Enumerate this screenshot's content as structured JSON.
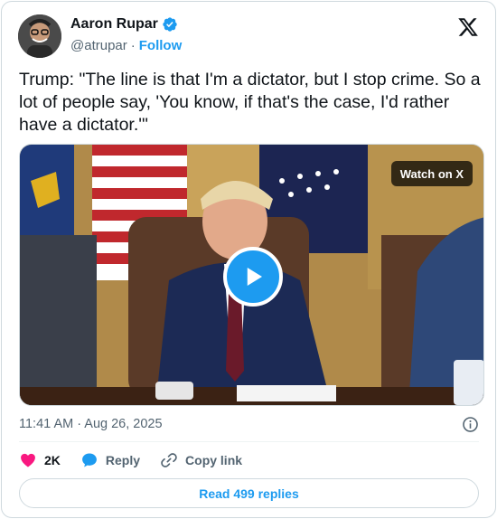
{
  "author": {
    "name": "Aaron Rupar",
    "handle": "@atrupar",
    "separator": "·",
    "follow_label": "Follow",
    "verified": true
  },
  "tweet": {
    "text": "Trump: \"The line is that I'm a dictator, but I stop crime. So a lot of people say, 'You know, if that's the case, I'd rather have a dictator.'\""
  },
  "media": {
    "watch_label": "Watch on X",
    "type": "video"
  },
  "meta": {
    "timestamp": "11:41 AM · Aug 26, 2025"
  },
  "actions": {
    "likes": "2K",
    "reply_label": "Reply",
    "copy_link_label": "Copy link"
  },
  "read_replies_label": "Read 499 replies",
  "colors": {
    "accent": "#1d9bf0",
    "like": "#f91880",
    "text": "#0f1419",
    "muted": "#536471"
  }
}
